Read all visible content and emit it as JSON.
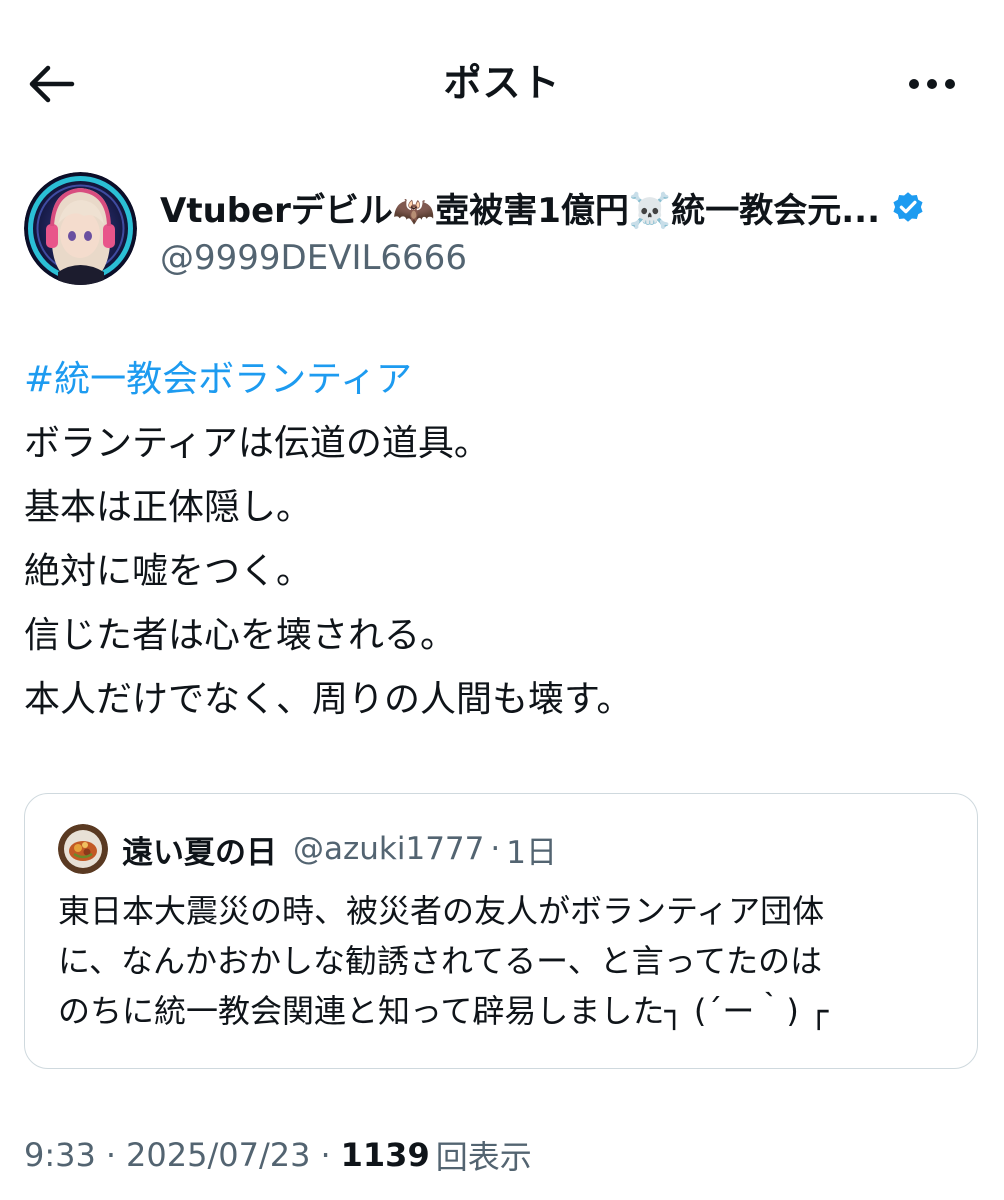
{
  "header": {
    "title": "ポスト",
    "back_icon": "arrow-left-icon",
    "more_icon": "more-horizontal-icon"
  },
  "author": {
    "display_name": "Vtuberデビル🦇壺被害1億円☠️統一教会元...",
    "handle": "@9999DEVIL6666",
    "verified": true,
    "verified_color": "#1d9bf0"
  },
  "post": {
    "hashtag": "#統一教会ボランティア",
    "lines": [
      "ボランティアは伝道の道具。",
      "基本は正体隠し。",
      "絶対に嘘をつく。",
      "信じた者は心を壊される。",
      "本人だけでなく、周りの人間も壊す。"
    ]
  },
  "quote": {
    "display_name": "遠い夏の日",
    "handle": "@azuki1777",
    "separator": "·",
    "time": "1日",
    "lines": [
      "東日本大震災の時、被災者の友人がボランティア団体",
      "に、なんかおかしな勧誘されてるー、と言ってたのは",
      "のちに統一教会関連と知って辟易しました┐ (´ー｀) ┌"
    ]
  },
  "meta": {
    "time": "9:33",
    "separator": "·",
    "date": "2025/07/23",
    "views_count": "1139",
    "views_label": "回表示"
  },
  "colors": {
    "link": "#1d9bf0",
    "text_primary": "#0f1419",
    "text_secondary": "#536471",
    "border": "#cfd9de"
  }
}
